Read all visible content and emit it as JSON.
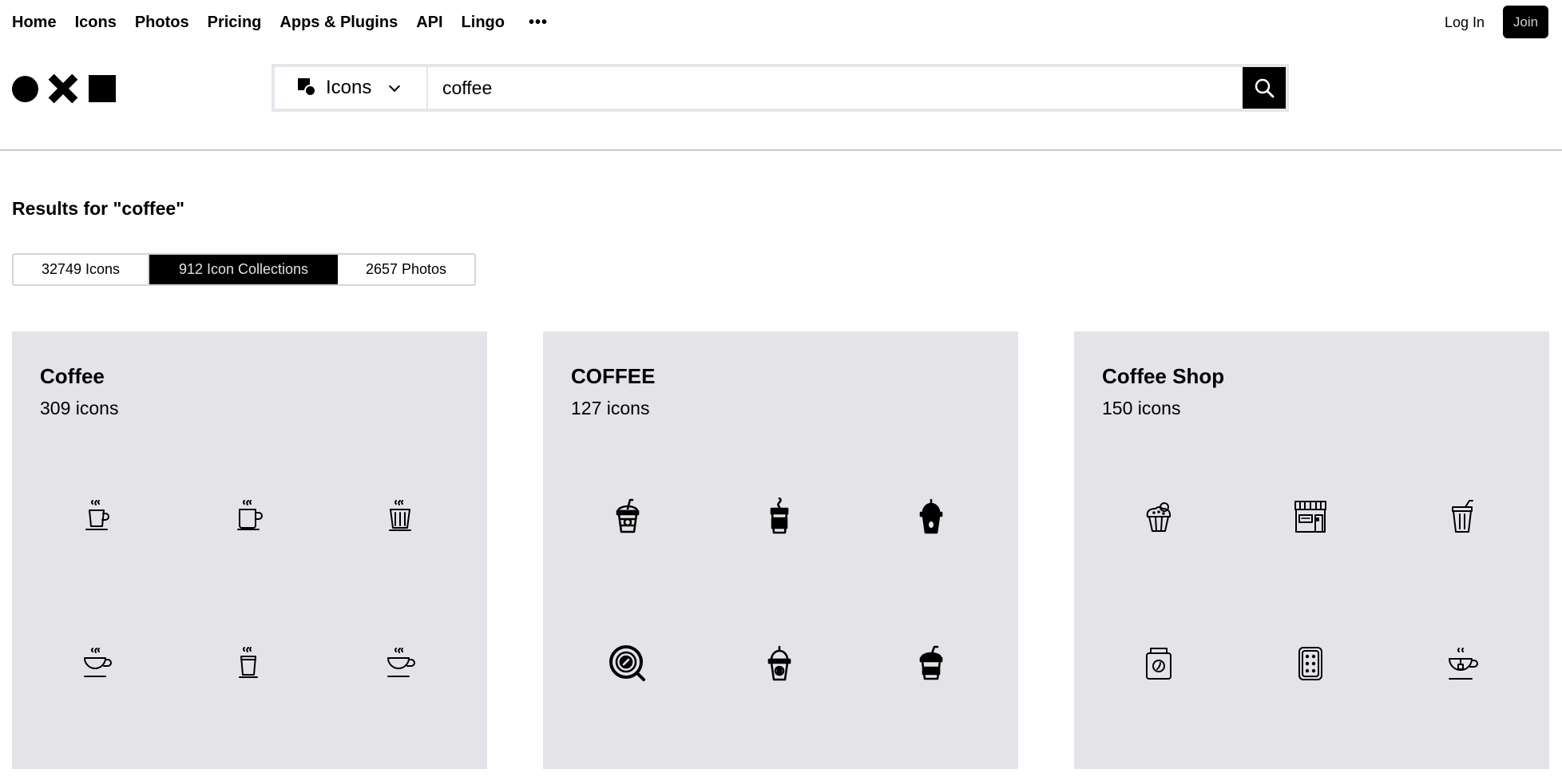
{
  "nav": {
    "links": [
      "Home",
      "Icons",
      "Photos",
      "Pricing",
      "Apps & Plugins",
      "API",
      "Lingo"
    ],
    "more": "•••",
    "login": "Log In",
    "join": "Join"
  },
  "search": {
    "scope": "Icons",
    "query": "coffee"
  },
  "results_heading": "Results for \"coffee\"",
  "tabs": {
    "icons": "32749 Icons",
    "collections": "912 Icon Collections",
    "photos": "2657 Photos",
    "active": "collections"
  },
  "cards": [
    {
      "title": "Coffee",
      "count": "309 icons",
      "icons": [
        "steaming-cup-saucer-icon",
        "steaming-mug-icon",
        "steaming-ribbed-cup-icon",
        "steaming-teacup-icon",
        "steaming-glass-icon",
        "steaming-teacup-icon"
      ]
    },
    {
      "title": "COFFEE",
      "count": "127 icons",
      "icons": [
        "takeaway-cup-straw-icon",
        "takeaway-cup-steam-icon",
        "dome-lid-cup-icon",
        "coffee-cup-top-view-icon",
        "dome-lid-cup-outline-icon",
        "takeaway-cup-straw-dark-icon"
      ]
    },
    {
      "title": "Coffee Shop",
      "count": "150 icons",
      "icons": [
        "cupcake-icon",
        "coffee-shop-storefront-icon",
        "cup-with-lid-icon",
        "coffee-bean-jar-icon",
        "biscuit-icon",
        "tea-cup-teabag-icon"
      ]
    }
  ]
}
